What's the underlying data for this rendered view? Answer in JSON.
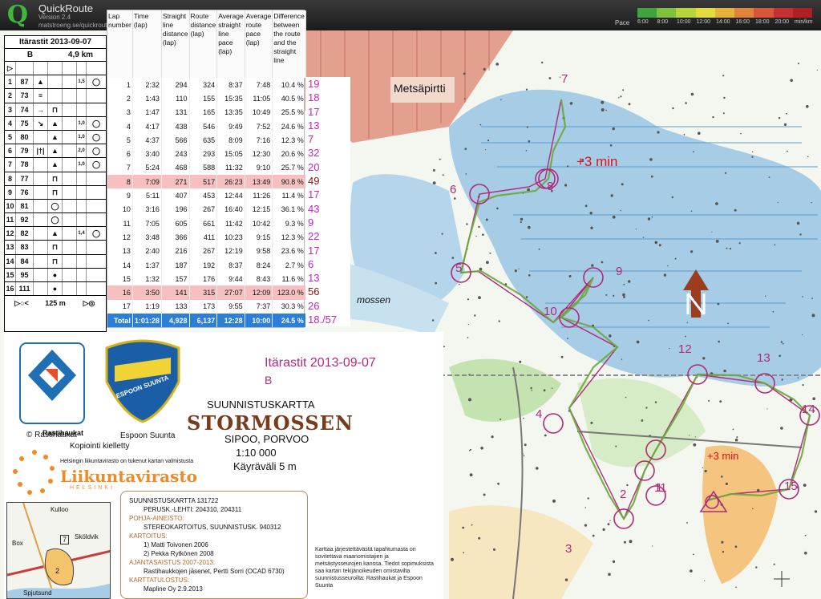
{
  "app": {
    "name": "QuickRoute",
    "version": "Version 2.4",
    "url": "matstroeng.se/quickroute",
    "pace_label": "Pace",
    "pace_ticks": [
      "6:00",
      "8:00",
      "10:00",
      "12:00",
      "14:00",
      "16:00",
      "18:00",
      "20:00",
      "min/km"
    ],
    "pace_colors": [
      "#3fa33f",
      "#7cc23c",
      "#b7d43a",
      "#e4dc3c",
      "#e8b23a",
      "#e2833a",
      "#d9563a",
      "#c73030",
      "#b02020"
    ]
  },
  "card": {
    "title": "Itärastit 2013-09-07",
    "course": "B",
    "length": "4,9 km",
    "rows": [
      [
        "1",
        "87",
        "▲",
        "",
        "",
        "1,5",
        "◯"
      ],
      [
        "2",
        "73",
        "≡",
        "",
        "",
        "",
        ""
      ],
      [
        "3",
        "74",
        "→",
        "⊓",
        "",
        "",
        ""
      ],
      [
        "4",
        "75",
        "↘",
        "▲",
        "",
        "1,0",
        "◯"
      ],
      [
        "5",
        "80",
        "",
        "▲",
        "",
        "1,0",
        "◯"
      ],
      [
        "6",
        "79",
        "|†|",
        "▲",
        "",
        "2,0",
        "◯"
      ],
      [
        "7",
        "78",
        "",
        "▲",
        "",
        "1,0",
        "◯"
      ],
      [
        "8",
        "77",
        "",
        "⊓",
        "",
        "",
        ""
      ],
      [
        "9",
        "76",
        "",
        "⊓",
        "",
        "",
        ""
      ],
      [
        "10",
        "81",
        "",
        "◯",
        "",
        "",
        ""
      ],
      [
        "11",
        "92",
        "",
        "◯",
        "",
        "",
        ""
      ],
      [
        "12",
        "82",
        "",
        "▲",
        "",
        "1,4",
        "◯"
      ],
      [
        "13",
        "83",
        "",
        "⊓",
        "",
        "",
        ""
      ],
      [
        "14",
        "84",
        "",
        "⊓",
        "",
        "",
        ""
      ],
      [
        "15",
        "95",
        "",
        "●",
        "",
        "",
        ""
      ],
      [
        "16",
        "111",
        "",
        "●",
        "",
        "",
        ""
      ]
    ],
    "footer_left": "▷○<",
    "footer_dist": "125 m",
    "footer_right": "▷◎"
  },
  "laps": {
    "headers": [
      "Lap number",
      "Time (lap)",
      "Straight line distance (lap)",
      "Route distance (lap)",
      "Average straight line pace (lap)",
      "Average route pace (lap)",
      "Difference between the route and the straight line"
    ],
    "rows": [
      {
        "lap": "1",
        "time": "2:32",
        "straight": "294",
        "route": "324",
        "sl_pace": "8:37",
        "r_pace": "7:48",
        "diff": "10.4 %",
        "place": "19",
        "hl": false
      },
      {
        "lap": "2",
        "time": "1:43",
        "straight": "110",
        "route": "155",
        "sl_pace": "15:35",
        "r_pace": "11:05",
        "diff": "40.5 %",
        "place": "18",
        "hl": false
      },
      {
        "lap": "3",
        "time": "1:47",
        "straight": "131",
        "route": "165",
        "sl_pace": "13:35",
        "r_pace": "10:49",
        "diff": "25.5 %",
        "place": "17",
        "hl": false
      },
      {
        "lap": "4",
        "time": "4:17",
        "straight": "438",
        "route": "546",
        "sl_pace": "9:49",
        "r_pace": "7:52",
        "diff": "24.6 %",
        "place": "13",
        "hl": false
      },
      {
        "lap": "5",
        "time": "4:37",
        "straight": "566",
        "route": "635",
        "sl_pace": "8:09",
        "r_pace": "7:16",
        "diff": "12.3 %",
        "place": "7",
        "hl": false
      },
      {
        "lap": "6",
        "time": "3:40",
        "straight": "243",
        "route": "293",
        "sl_pace": "15:05",
        "r_pace": "12:30",
        "diff": "20.6 %",
        "place": "32",
        "hl": false
      },
      {
        "lap": "7",
        "time": "5:24",
        "straight": "468",
        "route": "588",
        "sl_pace": "11:32",
        "r_pace": "9:10",
        "diff": "25.7 %",
        "place": "20",
        "hl": false
      },
      {
        "lap": "8",
        "time": "7:09",
        "straight": "271",
        "route": "517",
        "sl_pace": "26:23",
        "r_pace": "13:49",
        "diff": "90.8 %",
        "place": "49",
        "hl": true
      },
      {
        "lap": "9",
        "time": "5:11",
        "straight": "407",
        "route": "453",
        "sl_pace": "12:44",
        "r_pace": "11:26",
        "diff": "11.4 %",
        "place": "17",
        "hl": false
      },
      {
        "lap": "10",
        "time": "3:16",
        "straight": "196",
        "route": "267",
        "sl_pace": "16:40",
        "r_pace": "12:15",
        "diff": "36.1 %",
        "place": "43",
        "hl": false
      },
      {
        "lap": "11",
        "time": "7:05",
        "straight": "605",
        "route": "661",
        "sl_pace": "11:42",
        "r_pace": "10:42",
        "diff": "9.3 %",
        "place": "9",
        "hl": false
      },
      {
        "lap": "12",
        "time": "3:48",
        "straight": "366",
        "route": "411",
        "sl_pace": "10:23",
        "r_pace": "9:15",
        "diff": "12.3 %",
        "place": "22",
        "hl": false
      },
      {
        "lap": "13",
        "time": "2:40",
        "straight": "216",
        "route": "267",
        "sl_pace": "12:19",
        "r_pace": "9:58",
        "diff": "23.6 %",
        "place": "17",
        "hl": false
      },
      {
        "lap": "14",
        "time": "1:37",
        "straight": "187",
        "route": "192",
        "sl_pace": "8:37",
        "r_pace": "8:24",
        "diff": "2.7 %",
        "place": "6",
        "hl": false
      },
      {
        "lap": "15",
        "time": "1:32",
        "straight": "157",
        "route": "176",
        "sl_pace": "9:44",
        "r_pace": "8:43",
        "diff": "11.6 %",
        "place": "13",
        "hl": false
      },
      {
        "lap": "16",
        "time": "3:50",
        "straight": "141",
        "route": "315",
        "sl_pace": "27:07",
        "r_pace": "12:09",
        "diff": "123.0 %",
        "place": "56",
        "hl": true
      },
      {
        "lap": "17",
        "time": "1:19",
        "straight": "133",
        "route": "173",
        "sl_pace": "9:55",
        "r_pace": "7:37",
        "diff": "30.3 %",
        "place": "26",
        "hl": false
      }
    ],
    "total": {
      "lap": "Total",
      "time": "1:01:28",
      "straight": "4,928",
      "route": "6,137",
      "sl_pace": "12:28",
      "r_pace": "10:00",
      "diff": "24.5 %",
      "place": "18./57"
    }
  },
  "map_labels": {
    "metsapirtti": "Metsäpirtti",
    "stormossen_road": "mossen",
    "plus3_a": "+3 min",
    "plus3_b": "+3 min",
    "controls": [
      "1",
      "2",
      "3",
      "4",
      "5",
      "6",
      "7",
      "8",
      "9",
      "10",
      "11",
      "12",
      "13",
      "14",
      "15"
    ]
  },
  "legend": {
    "race": "Itärastit 2013-09-07",
    "course": "B",
    "org1": "Rastihaukat",
    "org2": "ESPOON SUUNTA",
    "copy": "© Rastihaukat",
    "club": "Espoon Suunta",
    "no_copy": "Kopiointi kielletty",
    "helsinki_note": "Helsingin liikuntavirasto on tukenut kartan valmistusta",
    "lv": "Liikuntavirasto",
    "lv_city": "HELSINKI",
    "map_type": "SUUNNISTUSKARTTA",
    "map_name": "STORMOSSEN",
    "place": "SIPOO, PORVOO",
    "scale": "1:10 000",
    "contour": "Käyräväli 5 m",
    "info": [
      "SUUNNISTUSKARTTA 131722",
      "PERUSK.-LEHTI: 204310, 204311",
      "POHJA-AINEISTO:",
      "STEREOKARTOITUS, SUUNNISTUSK. 940312",
      "KARTOITUS:",
      "1) Matti Toivonen 2006",
      "2) Pekka Rytkönen 2008",
      "AJANTASAISTUS 2007-2013:",
      "Rastihaukkojen jäsenet, Pertti Sorri (OCAD 6730)",
      "KARTTATULOSTUS:",
      "Mapline Oy   2.9.2013"
    ],
    "hint": "Karttaa järjestettävästä tapahtumasta on sovitettava maanomistajien ja metsästysseurojen kanssa. Tiedot sopimuksista saa kartan tekijänoikeuden omistavilta suunnistusseuroilta: Rastihaukat ja Espoon Suunta",
    "inset": [
      "Kulloo",
      "Box",
      "Sköldvik",
      "Spjutsund",
      "7",
      "2"
    ]
  }
}
